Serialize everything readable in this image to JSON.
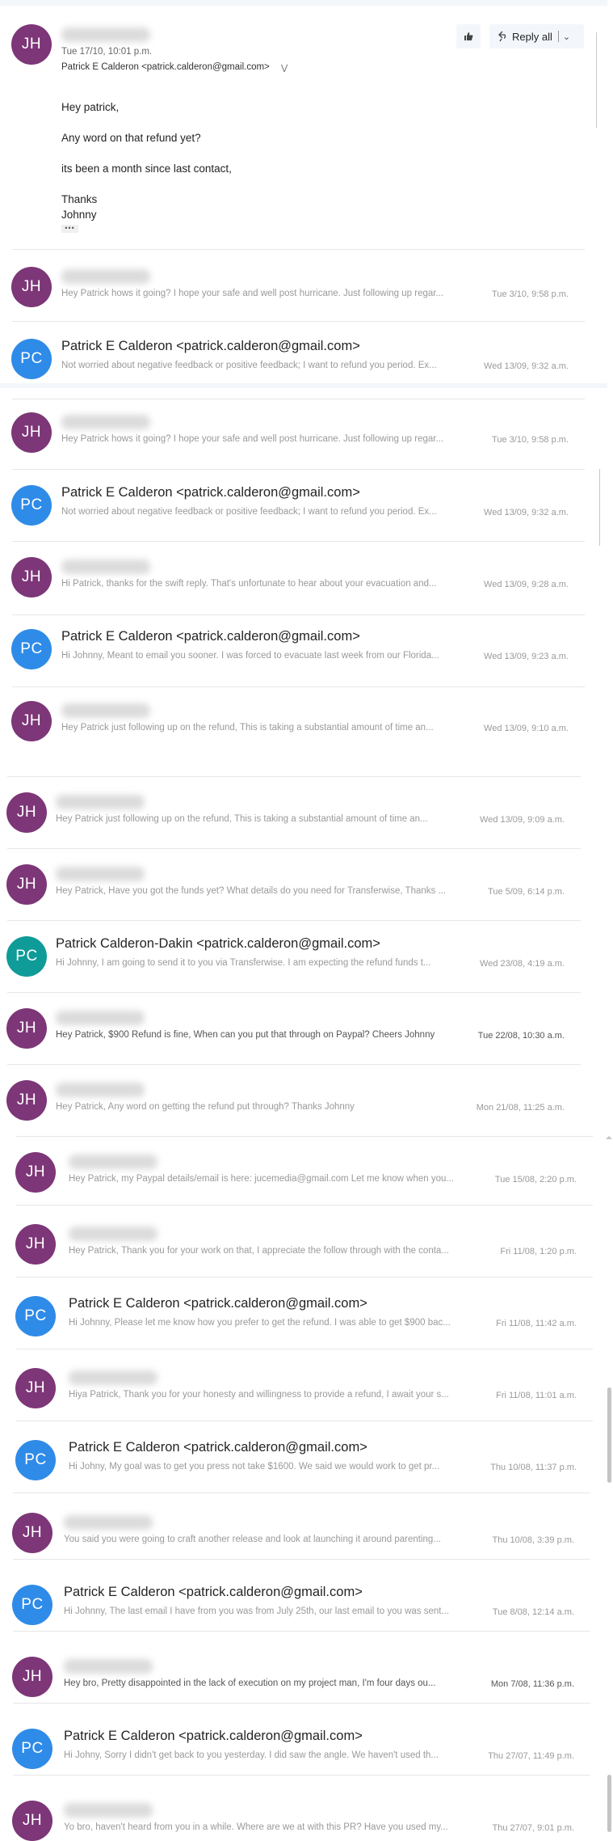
{
  "expanded_message": {
    "avatar_initials": "JH",
    "sender_name_redacted": true,
    "date": "Tue 17/10, 10:01 p.m.",
    "to": "Patrick E Calderon <patrick.calderon@gmail.com>",
    "body_lines": [
      "Hey patrick,",
      "Any word on that refund yet?",
      "its been a month since last contact,",
      "Thanks",
      "Johnny"
    ],
    "more_label": "•••",
    "actions": {
      "like_icon": "thumbs-up-icon",
      "reply_all_label": "Reply all",
      "reply_all_icon": "reply-all-icon",
      "dropdown_icon": "chevron-down-icon"
    }
  },
  "messages": [
    {
      "initials": "JH",
      "sender": "",
      "redacted": true,
      "preview": "Hey Patrick hows it going? I hope your safe and well post hurricane. Just following up regar...",
      "time": "Tue 3/10, 9:58 p.m.",
      "color": "#7d3677"
    },
    {
      "initials": "PC",
      "sender": "Patrick E Calderon <patrick.calderon@gmail.com>",
      "redacted": false,
      "preview": "Not worried about negative feedback or positive feedback; I want to refund you period. Ex...",
      "time": "Wed 13/09, 9:32 a.m.",
      "color": "#2f8be8"
    },
    {
      "initials": "JH",
      "sender": "",
      "redacted": true,
      "preview": "Hey Patrick hows it going? I hope your safe and well post hurricane. Just following up regar...",
      "time": "Tue 3/10, 9:58 p.m.",
      "color": "#7d3677"
    },
    {
      "initials": "PC",
      "sender": "Patrick E Calderon <patrick.calderon@gmail.com>",
      "redacted": false,
      "preview": "Not worried about negative feedback or positive feedback; I want to refund you period. Ex...",
      "time": "Wed 13/09, 9:32 a.m.",
      "color": "#2f8be8"
    },
    {
      "initials": "JH",
      "sender": "",
      "redacted": true,
      "preview": "Hi Patrick, thanks for the swift reply. That's unfortunate to hear about your evacuation and...",
      "time": "Wed 13/09, 9:28 a.m.",
      "color": "#7d3677"
    },
    {
      "initials": "PC",
      "sender": "Patrick E Calderon <patrick.calderon@gmail.com>",
      "redacted": false,
      "preview": "Hi Johnny, Meant to email you sooner. I was forced to evacuate last week from our Florida...",
      "time": "Wed 13/09, 9:23 a.m.",
      "color": "#2f8be8"
    },
    {
      "initials": "JH",
      "sender": "",
      "redacted": true,
      "preview": "Hey Patrick just following up on the refund, This is taking a substantial amount of time an...",
      "time": "Wed 13/09, 9:10 a.m.",
      "color": "#7d3677"
    },
    {
      "initials": "JH",
      "sender": "",
      "redacted": true,
      "preview": "Hey Patrick just following up on the refund, This is taking a substantial amount of time an...",
      "time": "Wed 13/09, 9:09 a.m.",
      "color": "#7d3677"
    },
    {
      "initials": "JH",
      "sender": "",
      "redacted": true,
      "preview": "Hey Patrick, Have you got the funds yet? What details do you need for Transferwise, Thanks ...",
      "time": "Tue 5/09, 6:14 p.m.",
      "color": "#7d3677"
    },
    {
      "initials": "PC",
      "sender": "Patrick Calderon-Dakin <patrick.calderon@gmail.com>",
      "redacted": false,
      "preview": "Hi Johnny, I am going to send it to you via Transferwise. I am expecting the refund funds t...",
      "time": "Wed 23/08, 4:19 a.m.",
      "color": "#0f9b98"
    },
    {
      "initials": "JH",
      "sender": "",
      "redacted": true,
      "preview": "Hey Patrick, $900 Refund is fine, When can you put that through on Paypal? Cheers Johnny",
      "time": "Tue 22/08, 10:30 a.m.",
      "color": "#7d3677",
      "unread": true
    },
    {
      "initials": "JH",
      "sender": "",
      "redacted": true,
      "preview": "Hey Patrick, Any word on getting the refund put through? Thanks Johnny",
      "time": "Mon 21/08, 11:25 a.m.",
      "color": "#7d3677"
    },
    {
      "initials": "JH",
      "sender": "",
      "redacted": true,
      "preview": "Hey Patrick, my Paypal details/email is here: jucemedia@gmail.com Let me know when you...",
      "time": "Tue 15/08, 2:20 p.m.",
      "color": "#7d3677"
    },
    {
      "initials": "JH",
      "sender": "",
      "redacted": true,
      "preview": "Hey Patrick, Thank you for your work on that, I appreciate the follow through with the conta...",
      "time": "Fri 11/08, 1:20 p.m.",
      "color": "#7d3677"
    },
    {
      "initials": "PC",
      "sender": "Patrick E Calderon <patrick.calderon@gmail.com>",
      "redacted": false,
      "preview": "Hi Johnny, Please let me know how you prefer to get the refund. I was able to get $900 bac...",
      "time": "Fri 11/08, 11:42 a.m.",
      "color": "#2f8be8"
    },
    {
      "initials": "JH",
      "sender": "",
      "redacted": true,
      "preview": "Hiya Patrick, Thank you for your honesty and willingness to provide a refund, I await your s...",
      "time": "Fri 11/08, 11:01 a.m.",
      "color": "#7d3677"
    },
    {
      "initials": "PC",
      "sender": "Patrick E Calderon <patrick.calderon@gmail.com>",
      "redacted": false,
      "preview": "Hi Johny, My goal was to get you press not take $1600. We said we would work to get pr...",
      "time": "Thu 10/08, 11:37 p.m.",
      "color": "#2f8be8"
    },
    {
      "initials": "JH",
      "sender": "",
      "redacted": true,
      "preview": "You said you were going to craft another release and look at launching it around parenting...",
      "time": "Thu 10/08, 3:39 p.m.",
      "color": "#7d3677"
    },
    {
      "initials": "PC",
      "sender": "Patrick E Calderon <patrick.calderon@gmail.com>",
      "redacted": false,
      "preview": "Hi Johnny, The last email I have from you was from July 25th, our last email to you was sent...",
      "time": "Tue 8/08, 12:14 a.m.",
      "color": "#2f8be8"
    },
    {
      "initials": "JH",
      "sender": "",
      "redacted": true,
      "preview": "Hey bro, Pretty disappointed in the lack of execution on my project man, I'm four days ou...",
      "time": "Mon 7/08, 11:36 p.m.",
      "color": "#7d3677",
      "unread": true
    },
    {
      "initials": "PC",
      "sender": "Patrick E Calderon <patrick.calderon@gmail.com>",
      "redacted": false,
      "preview": "Hi Johny, Sorry I didn't get back to you yesterday. I did saw the angle. We haven't used th...",
      "time": "Thu 27/07, 11:49 p.m.",
      "color": "#2f8be8"
    },
    {
      "initials": "JH",
      "sender": "",
      "redacted": true,
      "preview": "Yo bro, haven't heard from you in a while. Where are we at with this PR? Have you used my...",
      "time": "Thu 27/07, 9:01 p.m.",
      "color": "#7d3677"
    }
  ]
}
